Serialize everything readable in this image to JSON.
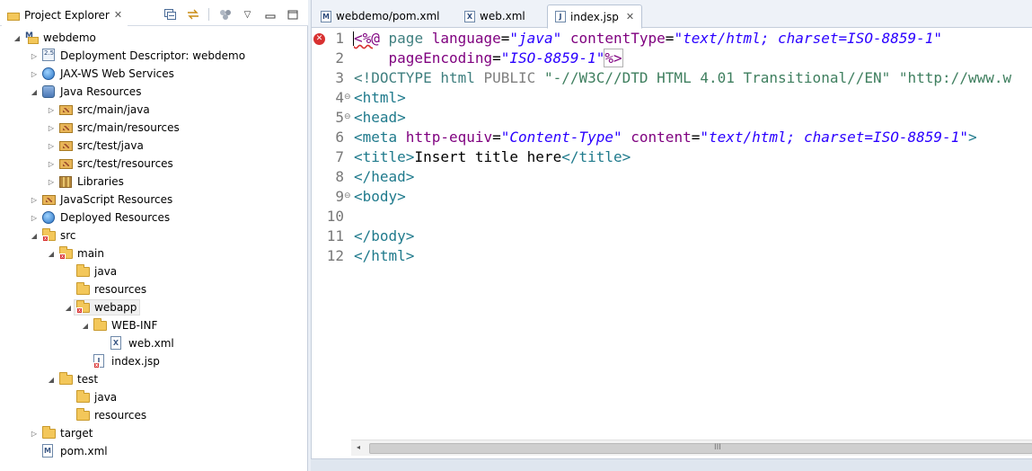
{
  "explorer": {
    "title": "Project Explorer",
    "close": "✕",
    "toolbar": {
      "collapse_all": "▭",
      "link_editor": "⇆",
      "menu": "▽",
      "minimize": "▭",
      "maximize": "☐"
    },
    "tree": [
      {
        "label": "webdemo",
        "icon": "maven-project-icon",
        "arrow": "▲"
      },
      {
        "label": "Deployment Descriptor: webdemo",
        "icon": "descriptor-icon",
        "arrow": "▷"
      },
      {
        "label": "JAX-WS Web Services",
        "icon": "web-services-icon",
        "arrow": "▷"
      },
      {
        "label": "Java Resources",
        "icon": "java-resources-icon",
        "arrow": "▲"
      },
      {
        "label": "src/main/java",
        "icon": "package-folder-icon",
        "arrow": "▷"
      },
      {
        "label": "src/main/resources",
        "icon": "package-folder-icon",
        "arrow": "▷"
      },
      {
        "label": "src/test/java",
        "icon": "package-folder-icon",
        "arrow": "▷"
      },
      {
        "label": "src/test/resources",
        "icon": "package-folder-icon",
        "arrow": "▷"
      },
      {
        "label": "Libraries",
        "icon": "libraries-icon",
        "arrow": "▷"
      },
      {
        "label": "JavaScript Resources",
        "icon": "js-resources-icon",
        "arrow": "▷"
      },
      {
        "label": "Deployed Resources",
        "icon": "globe-icon",
        "arrow": "▷"
      },
      {
        "label": "src",
        "icon": "folder-error-icon",
        "arrow": "▲"
      },
      {
        "label": "main",
        "icon": "folder-error-icon",
        "arrow": "▲"
      },
      {
        "label": "java",
        "icon": "folder-icon",
        "arrow": ""
      },
      {
        "label": "resources",
        "icon": "folder-icon",
        "arrow": ""
      },
      {
        "label": "webapp",
        "icon": "folder-error-icon",
        "arrow": "▲"
      },
      {
        "label": "WEB-INF",
        "icon": "folder-icon",
        "arrow": "▲"
      },
      {
        "label": "web.xml",
        "icon": "xml-file-icon",
        "arrow": ""
      },
      {
        "label": "index.jsp",
        "icon": "jsp-error-icon",
        "arrow": ""
      },
      {
        "label": "test",
        "icon": "folder-icon",
        "arrow": "▲"
      },
      {
        "label": "java",
        "icon": "folder-icon",
        "arrow": ""
      },
      {
        "label": "resources",
        "icon": "folder-icon",
        "arrow": ""
      },
      {
        "label": "target",
        "icon": "folder-icon",
        "arrow": "▷"
      },
      {
        "label": "pom.xml",
        "icon": "maven-file-icon",
        "arrow": ""
      }
    ]
  },
  "editor": {
    "tabs": [
      {
        "label": "webdemo/pom.xml",
        "icon": "M"
      },
      {
        "label": "web.xml",
        "icon": "X"
      },
      {
        "label": "index.jsp",
        "icon": "J",
        "close": "✕"
      }
    ],
    "line_numbers": [
      "1",
      "2",
      "3",
      "4",
      "5",
      "6",
      "7",
      "8",
      "9",
      "10",
      "11",
      "12"
    ],
    "code": {
      "l1": {
        "a": "<%@",
        "b": " page ",
        "c": "language",
        "d": "=",
        "e": "\"java\"",
        "f": " contentType",
        "g": "=",
        "h": "\"text/html; charset=ISO-8859-1\""
      },
      "l2": {
        "a": "    pageEncoding",
        "b": "=",
        "c": "\"ISO-8859-1\"",
        "d": "%>"
      },
      "l3": {
        "a": "<!DOCTYPE",
        "b": " html ",
        "c": "PUBLIC ",
        "d": "\"-//W3C//DTD HTML 4.01 Transitional//EN\"",
        "e": " \"http://www.w"
      },
      "l4": {
        "a": "<html>"
      },
      "l5": {
        "a": "<head>"
      },
      "l6": {
        "a": "<meta",
        "b": " http-equiv",
        "c": "=",
        "d": "\"Content-Type\"",
        "e": " content",
        "f": "=",
        "g": "\"text/html; charset=ISO-8859-1\"",
        "h": ">"
      },
      "l7": {
        "a": "<title>",
        "b": "Insert title here",
        "c": "</title>"
      },
      "l8": {
        "a": "</head>"
      },
      "l9": {
        "a": "<body>"
      },
      "l11": {
        "a": "</body>"
      },
      "l12": {
        "a": "</html>"
      }
    },
    "fold_marker": "⊖",
    "error_marker": "✕",
    "scroll_left": "◂",
    "scroll_grip": "III"
  }
}
